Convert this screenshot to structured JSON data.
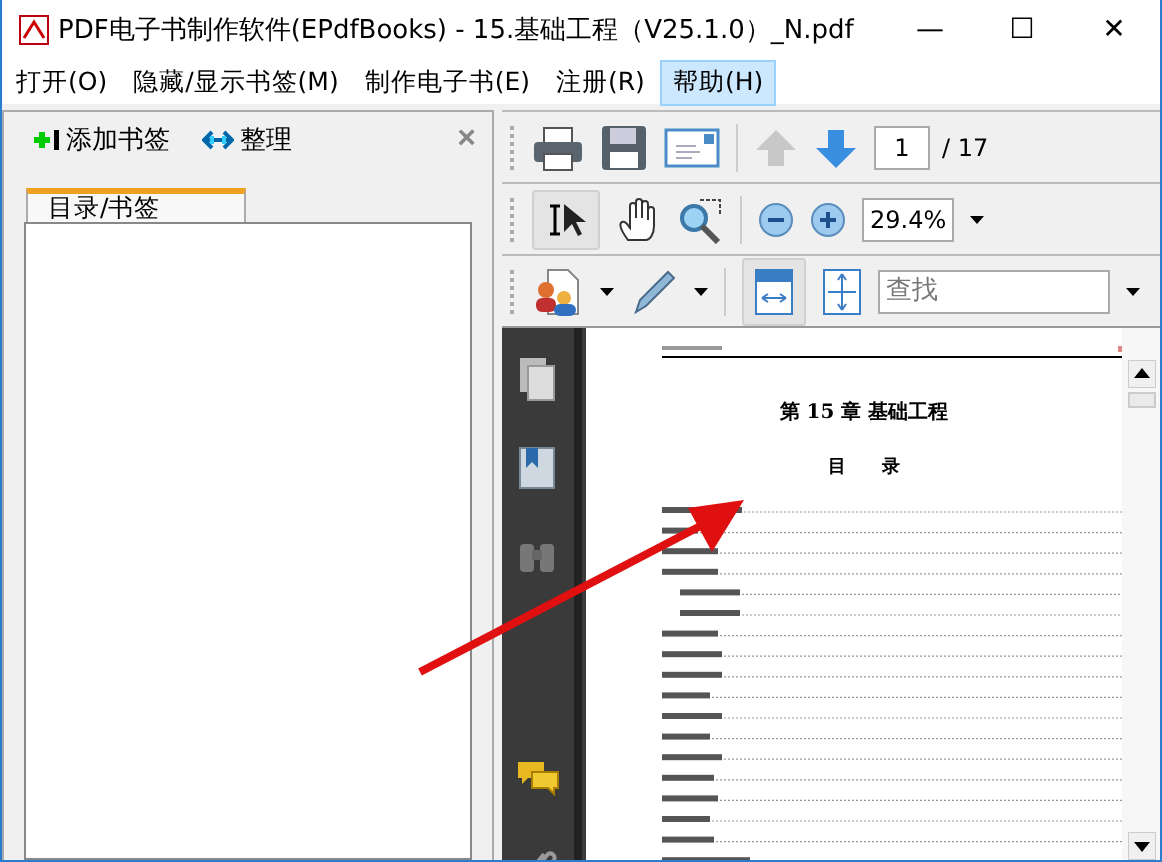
{
  "window": {
    "title": "PDF电子书制作软件(EPdfBooks) - 15.基础工程（V25.1.0）_N.pdf",
    "controls": [
      "—",
      "☐",
      "✕"
    ]
  },
  "menu": [
    {
      "label": "打开(O)",
      "selected": false
    },
    {
      "label": "隐藏/显示书签(M)",
      "selected": false
    },
    {
      "label": "制作电子书(E)",
      "selected": false
    },
    {
      "label": "注册(R)",
      "selected": false
    },
    {
      "label": "帮助(H)",
      "selected": true
    }
  ],
  "bookmarks": {
    "add": "添加书签",
    "organize": "整理",
    "close": "×",
    "tabs": [
      {
        "label": "目录/书签",
        "selected": true
      }
    ]
  },
  "toolbar": {
    "page": "1",
    "page_total": "/ 17",
    "zoom": "29.4%",
    "search": {
      "placeholder": "查找"
    }
  },
  "document": {
    "chapter": "第 15 章 基础工程",
    "toc_title": "目　　录"
  }
}
